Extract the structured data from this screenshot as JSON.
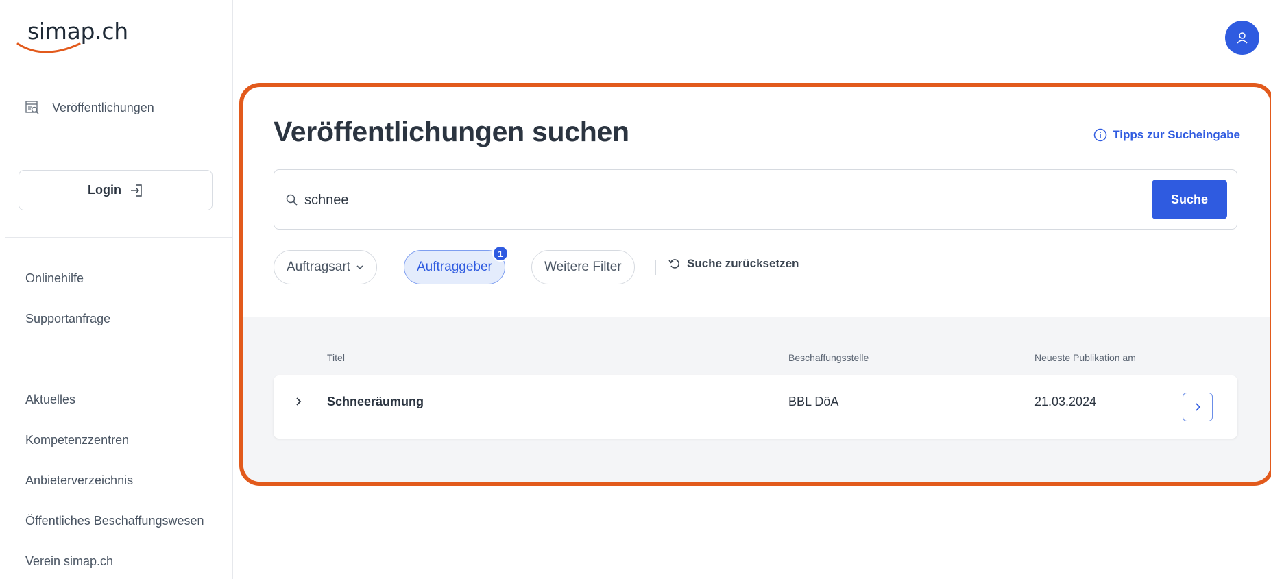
{
  "brand": {
    "logo_text": "simap.ch",
    "accent": "#e25a1c",
    "primary": "#2f5be0"
  },
  "sidebar": {
    "top_item": {
      "label": "Veröffentlichungen",
      "icon": "search-list-icon"
    },
    "login_label": "Login",
    "help_links": [
      "Onlinehilfe",
      "Supportanfrage"
    ],
    "info_links": [
      "Aktuelles",
      "Kompetenzzentren",
      "Anbieterverzeichnis",
      "Öffentliches Beschaffungswesen",
      "Verein simap.ch"
    ]
  },
  "header": {
    "avatar_icon": "user-icon"
  },
  "main": {
    "title": "Veröffentlichungen suchen",
    "tips_label": "Tipps zur Sucheingabe",
    "search": {
      "value": "schnee",
      "button_label": "Suche"
    },
    "filters": [
      {
        "label": "Auftragsart",
        "has_dropdown": true,
        "active": false
      },
      {
        "label": "Auftraggeber",
        "badge": "1",
        "active": true
      },
      {
        "label": "Weitere Filter",
        "active": false
      }
    ],
    "reset_label": "Suche zurücksetzen",
    "table": {
      "columns": [
        "Titel",
        "Beschaffungsstelle",
        "Neueste Publikation am"
      ],
      "rows": [
        {
          "title": "Schneeräumung",
          "office": "BBL DöA",
          "date": "21.03.2024"
        }
      ]
    }
  }
}
